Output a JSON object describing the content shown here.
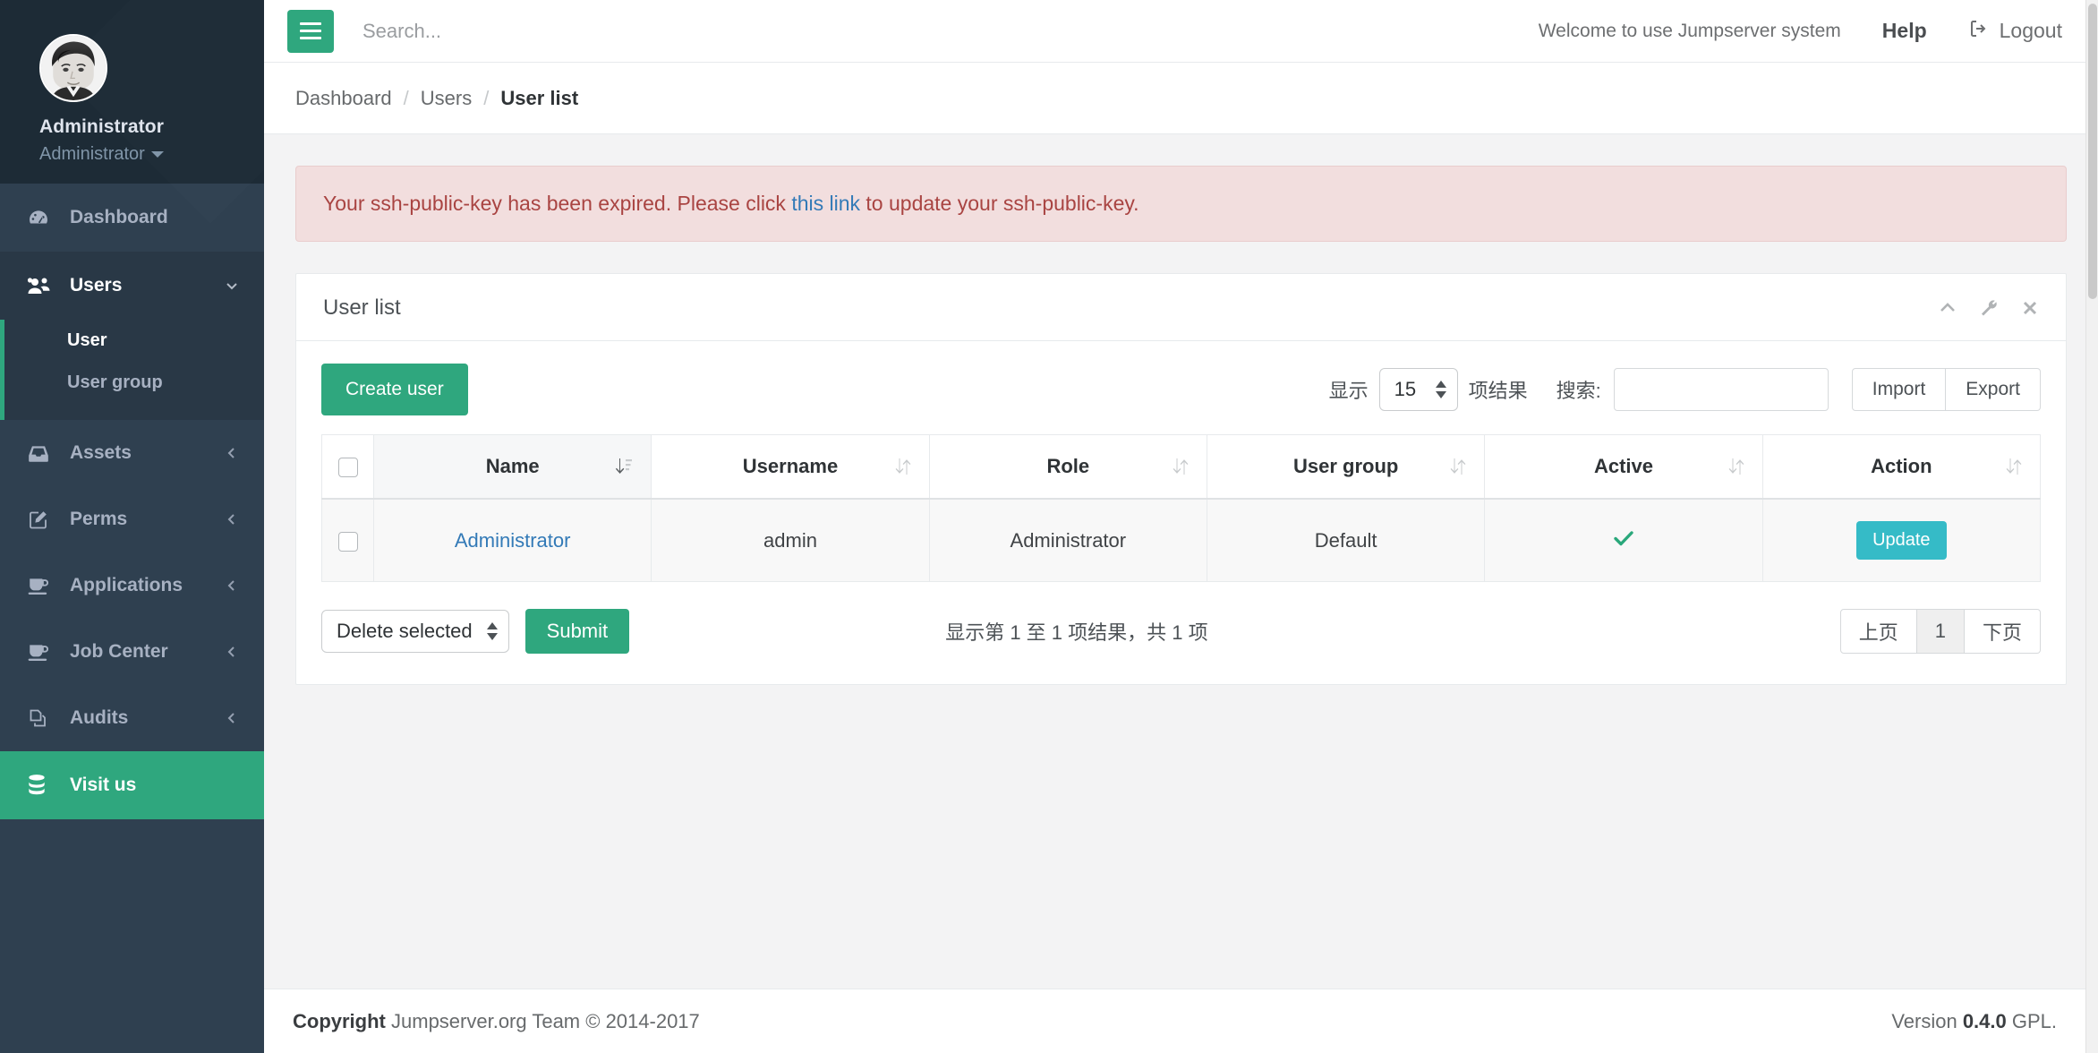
{
  "colors": {
    "sidebar_bg": "#2f4050",
    "sidebar_profile_bg": "#1d2b36",
    "accent_green": "#2fa77e",
    "update_teal": "#35bbc7",
    "link_blue": "#337ab7",
    "alert_bg": "#f2dede",
    "alert_text": "#a94442"
  },
  "sidebar": {
    "profile": {
      "avatar_icon": "user-avatar-photo",
      "name": "Administrator",
      "role": "Administrator",
      "caret_icon": "caret-down-icon"
    },
    "items": [
      {
        "label": "Dashboard",
        "icon": "dashboard-icon",
        "active": false,
        "expandable": false
      },
      {
        "label": "Users",
        "icon": "users-icon",
        "active": true,
        "expandable": true,
        "arrow_icon": "chevron-down-icon"
      },
      {
        "label": "Assets",
        "icon": "inbox-icon",
        "active": false,
        "expandable": true,
        "arrow_icon": "chevron-left-icon"
      },
      {
        "label": "Perms",
        "icon": "edit-pencil-icon",
        "active": false,
        "expandable": true,
        "arrow_icon": "chevron-left-icon"
      },
      {
        "label": "Applications",
        "icon": "coffee-cup-icon",
        "active": false,
        "expandable": true,
        "arrow_icon": "chevron-left-icon"
      },
      {
        "label": "Job Center",
        "icon": "coffee-cup-icon",
        "active": false,
        "expandable": true,
        "arrow_icon": "chevron-left-icon"
      },
      {
        "label": "Audits",
        "icon": "copy-files-icon",
        "active": false,
        "expandable": true,
        "arrow_icon": "chevron-left-icon"
      },
      {
        "label": "Visit us",
        "icon": "database-icon",
        "active": false,
        "expandable": false,
        "highlighted": true
      }
    ],
    "users_submenu": [
      {
        "label": "User",
        "active": true
      },
      {
        "label": "User group",
        "active": false
      }
    ]
  },
  "topbar": {
    "menu_toggle_icon": "hamburger-icon",
    "search_placeholder": "Search...",
    "search_value": "",
    "welcome_text": "Welcome to use Jumpserver system",
    "help_label": "Help",
    "logout_label": "Logout",
    "logout_icon": "sign-out-icon"
  },
  "breadcrumb": {
    "items": [
      "Dashboard",
      "Users",
      "User list"
    ],
    "separator": "/"
  },
  "alert": {
    "text_before": "Your ssh-public-key has been expired. Please click ",
    "link_text": "this link",
    "text_after": " to update your ssh-public-key."
  },
  "panel": {
    "title": "User list",
    "tools": [
      {
        "icon": "chevron-up-icon",
        "name": "collapse"
      },
      {
        "icon": "wrench-icon",
        "name": "settings"
      },
      {
        "icon": "close-x-icon",
        "name": "close"
      }
    ]
  },
  "toolbar": {
    "create_label": "Create user",
    "length_prefix": "显示",
    "length_value": "15",
    "length_suffix": "项结果",
    "search_label": "搜索:",
    "search_value": "",
    "import_label": "Import",
    "export_label": "Export"
  },
  "table": {
    "columns": [
      {
        "label": "",
        "sort": "none",
        "type": "checkbox"
      },
      {
        "label": "Name",
        "sort": "asc"
      },
      {
        "label": "Username",
        "sort": "none"
      },
      {
        "label": "Role",
        "sort": "none"
      },
      {
        "label": "User group",
        "sort": "none"
      },
      {
        "label": "Active",
        "sort": "none"
      },
      {
        "label": "Action",
        "sort": "none"
      }
    ],
    "rows": [
      {
        "name": "Administrator",
        "username": "admin",
        "role": "Administrator",
        "user_group": "Default",
        "active": true,
        "active_icon": "check-icon",
        "action_label": "Update"
      }
    ]
  },
  "table_footer": {
    "bulk_action": "Delete selected",
    "submit_label": "Submit",
    "info_text": "显示第 1 至 1 项结果，共 1 项",
    "pagination": {
      "prev_label": "上页",
      "pages": [
        "1"
      ],
      "current_page": "1",
      "next_label": "下页"
    }
  },
  "footer": {
    "copyright_bold": "Copyright",
    "copyright_text": " Jumpserver.org Team © 2014-2017",
    "version_prefix": "Version ",
    "version_number": "0.4.0",
    "version_suffix": " GPL."
  }
}
